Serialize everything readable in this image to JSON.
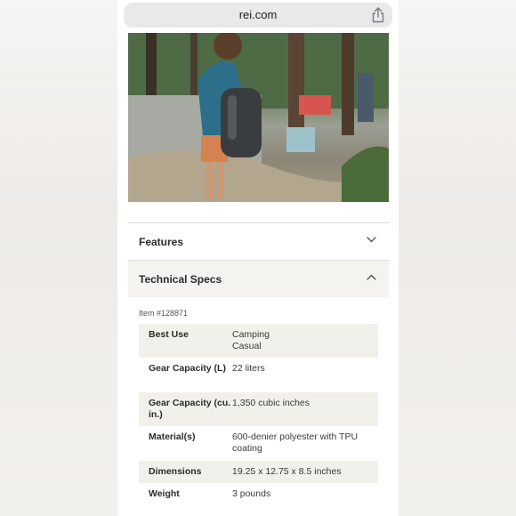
{
  "browser": {
    "url": "rei.com"
  },
  "accordion": {
    "features_label": "Features",
    "specs_label": "Technical Specs"
  },
  "specs": {
    "item_number": "Item #128871",
    "rows": [
      {
        "label": "Best Use",
        "value": "Camping\nCasual"
      },
      {
        "label": "Gear Capacity (L)",
        "value": "22 liters"
      },
      {
        "label": "Gear Capacity (cu. in.)",
        "value": "1,350 cubic inches"
      },
      {
        "label": "Material(s)",
        "value": "600-denier polyester with TPU coating"
      },
      {
        "label": "Dimensions",
        "value": "19.25 x 12.75 x 8.5 inches"
      },
      {
        "label": "Weight",
        "value": "3 pounds"
      }
    ]
  }
}
